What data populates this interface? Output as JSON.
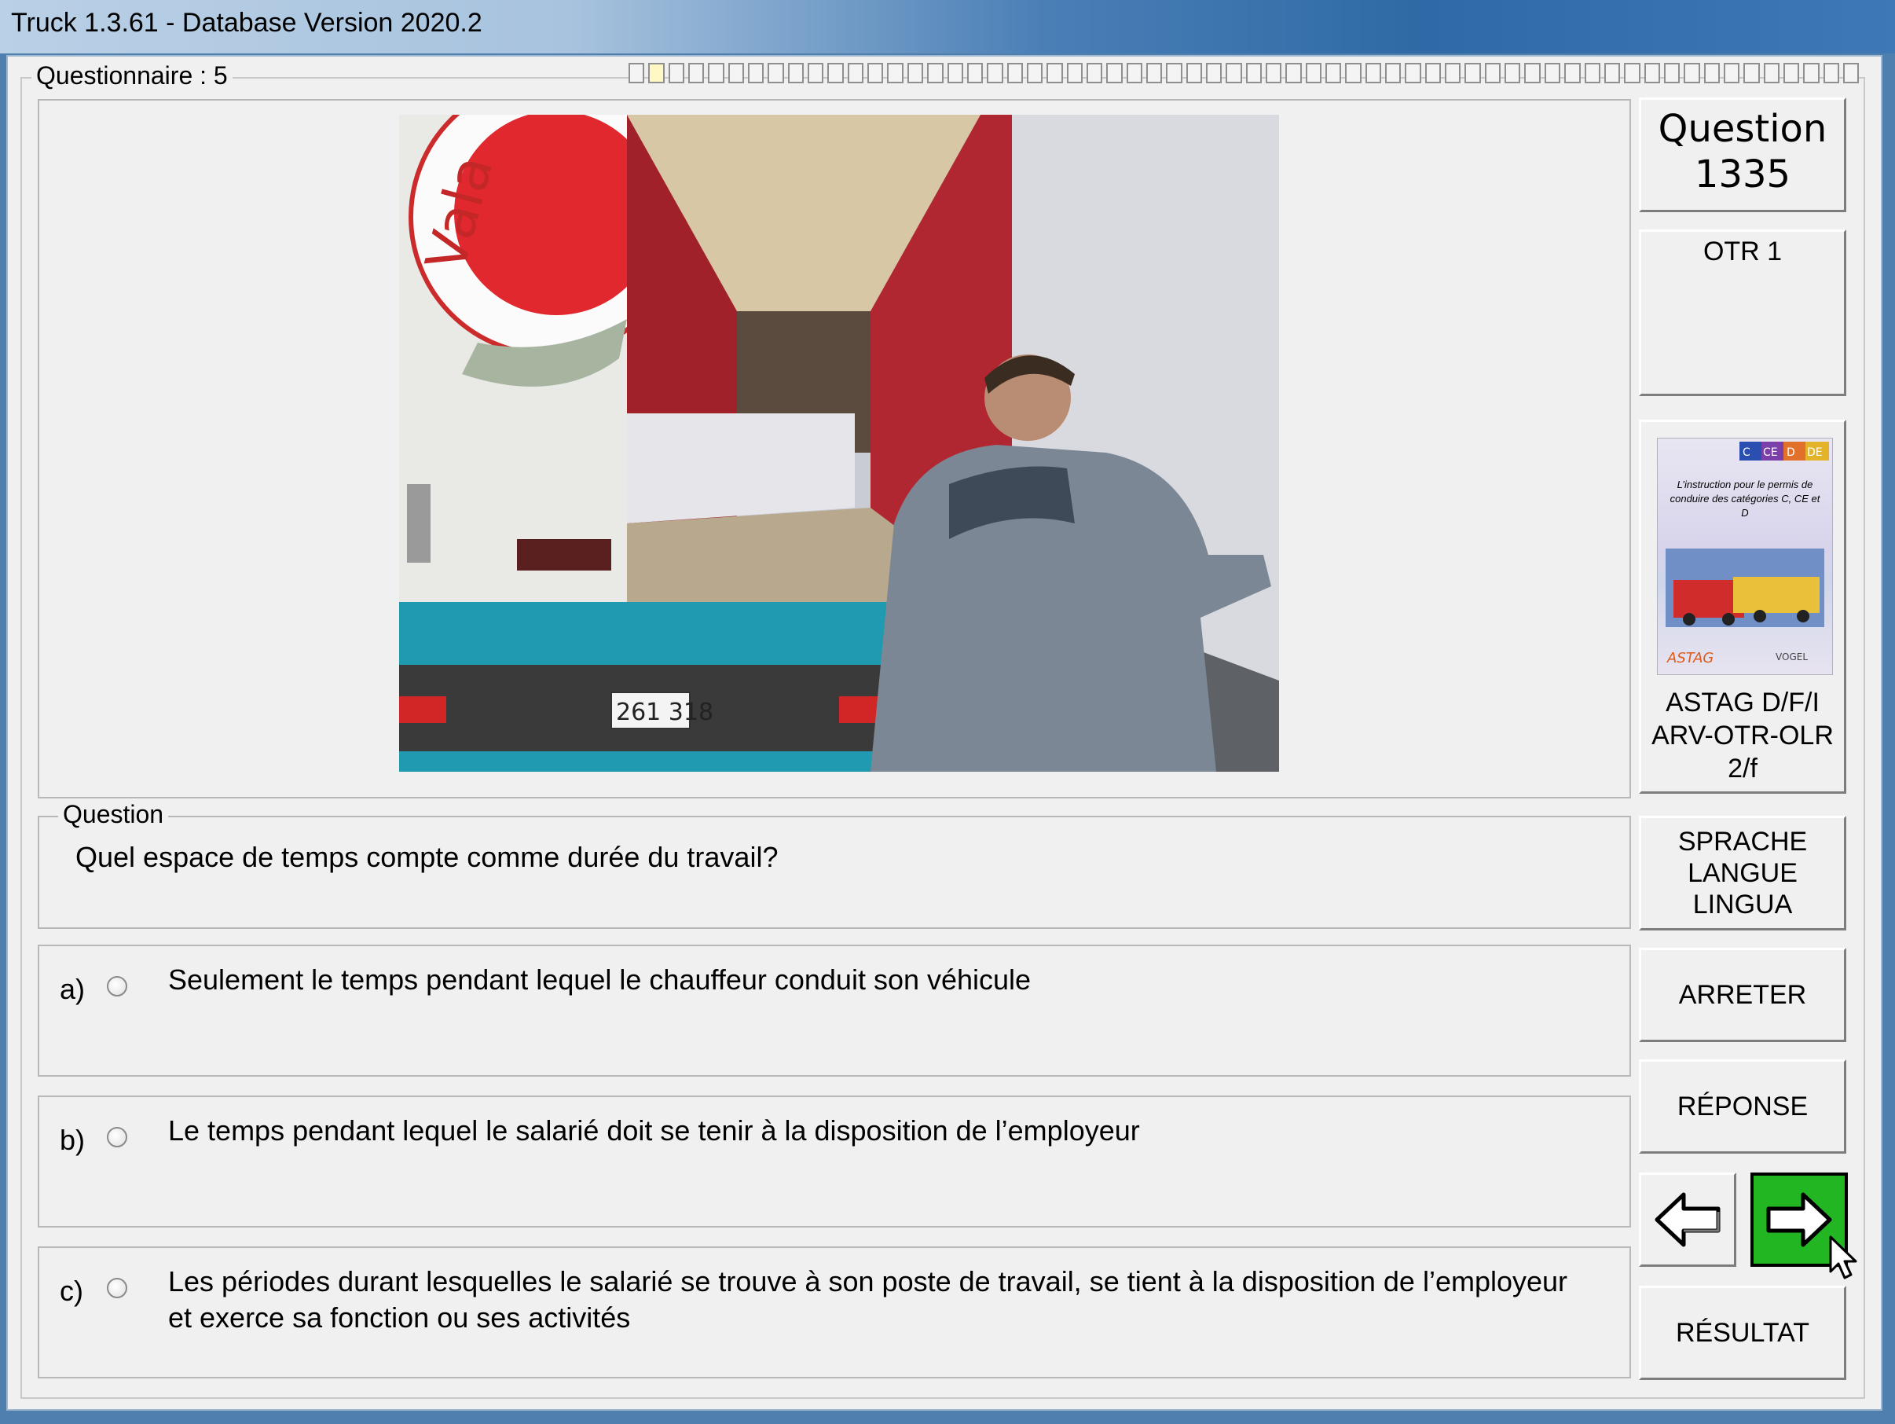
{
  "window": {
    "title": "Truck 1.3.61 - Database Version 2020.2"
  },
  "questionnaire": {
    "label": "Questionnaire : 5",
    "progress_total": 62,
    "progress_current": 2
  },
  "question": {
    "legend": "Question",
    "text": "Quel espace de temps compte comme durée du travail?",
    "number_label": "Question",
    "number": "1335",
    "category": "OTR 1"
  },
  "answers": [
    {
      "letter": "a)",
      "text": "Seulement le temps pendant lequel le chauffeur conduit son véhicule"
    },
    {
      "letter": "b)",
      "text": "Le temps pendant lequel le salarié doit se tenir à la disposition de l’employeur"
    },
    {
      "letter": "c)",
      "text": "Les périodes durant lesquelles le salarié se trouve à son poste de travail, se tient à la disposition de l’employeur et exerce sa fonction ou ses activités"
    }
  ],
  "book": {
    "badges": [
      "C",
      "CE",
      "D",
      "DE"
    ],
    "cover_text": "L’instruction pour le permis de conduire des catégories C, CE et D",
    "publisher_left": "ASTAG",
    "publisher_right": "VOGEL",
    "caption_line1": "ASTAG D/F/I",
    "caption_line2": "ARV-OTR-OLR",
    "caption_line3": "2/f"
  },
  "photo": {
    "plate": "261 318"
  },
  "buttons": {
    "language": [
      "SPRACHE",
      "LANGUE",
      "LINGUA"
    ],
    "stop": "ARRETER",
    "answer": "RÉPONSE",
    "result": "RÉSULTAT"
  }
}
